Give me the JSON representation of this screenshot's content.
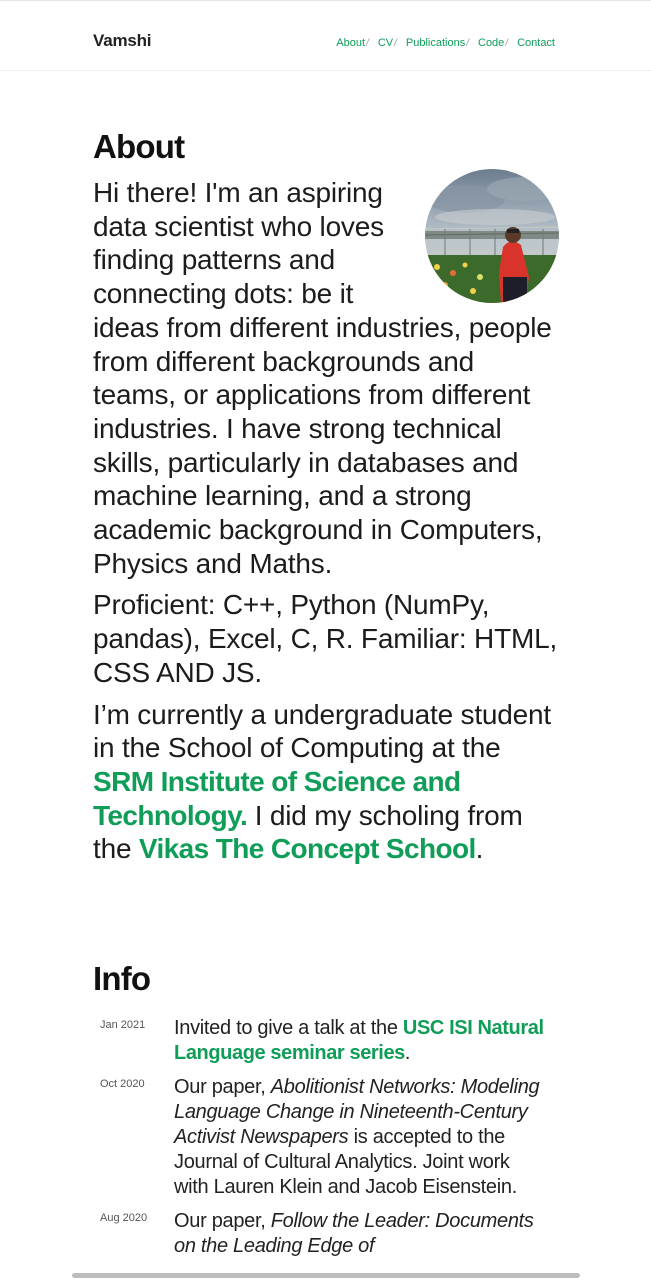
{
  "header": {
    "brand": "Vamshi",
    "nav": [
      {
        "label": "About",
        "sep": "/"
      },
      {
        "label": "CV",
        "sep": "/"
      },
      {
        "label": "Publications",
        "sep": "/"
      },
      {
        "label": "Code",
        "sep": "/"
      },
      {
        "label": "Contact",
        "sep": ""
      }
    ]
  },
  "about": {
    "heading": "About",
    "p1": "Hi there! I'm an aspiring data scientist who loves finding patterns and connecting dots: be it ideas from different industries, people from different backgrounds and teams, or applications from different industries. I have strong technical skills, particularly in databases and machine learning, and a strong academic background in Computers, Physics and Maths.",
    "p2": "Proficient: C++, Python (NumPy, pandas), Excel, C, R. Familiar: HTML, CSS AND JS.",
    "p3_before": "I’m currently a undergraduate student in the School of Computing at the ",
    "p3_link1": "SRM Institute of Science and Technology.",
    "p3_middle": " I did my scholing from the ",
    "p3_link2": "Vikas The Concept School",
    "p3_after": "."
  },
  "info": {
    "heading": "Info",
    "items": [
      {
        "date": "Jan 2021",
        "before": "Invited to give a talk at the ",
        "link": "USC ISI Natural Language seminar series",
        "after": "."
      },
      {
        "date": "Oct 2020",
        "before": "Our paper, ",
        "title": "Abolitionist Networks: Modeling Language Change in Nineteenth-Century Activist Newspapers",
        "after": " is accepted to the Journal of Cultural Analytics. Joint work with Lauren Klein and Jacob Eisenstein."
      },
      {
        "date": "Aug 2020",
        "before": "Our paper, ",
        "title": "Follow the Leader: Documents on the Leading Edge of"
      }
    ]
  },
  "colors": {
    "accent": "#0f9d58",
    "text": "#1c1c1c"
  }
}
